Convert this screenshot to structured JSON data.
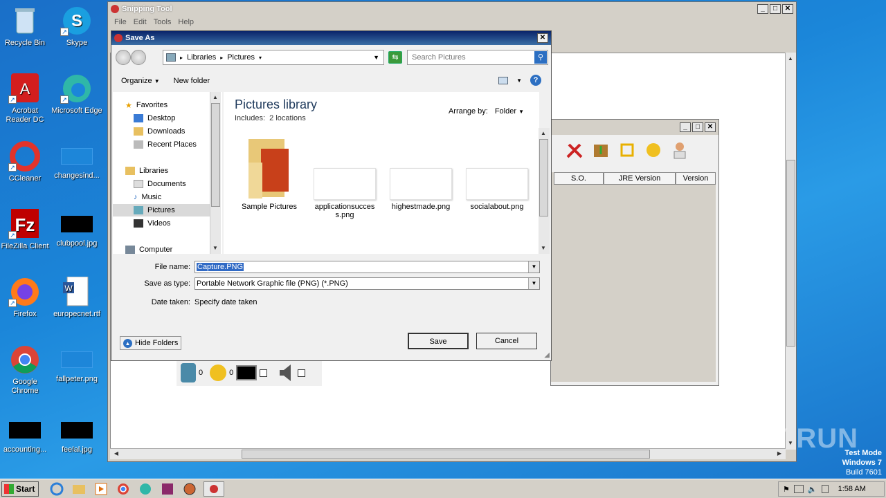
{
  "desktop": {
    "icons": [
      {
        "label": "Recycle Bin"
      },
      {
        "label": "Skype"
      },
      {
        "label": "Acrobat Reader DC"
      },
      {
        "label": "Microsoft Edge"
      },
      {
        "label": "CCleaner"
      },
      {
        "label": "changesind..."
      },
      {
        "label": "FileZilla Client"
      },
      {
        "label": "clubpool.jpg"
      },
      {
        "label": "Firefox"
      },
      {
        "label": "europecnet.rtf"
      },
      {
        "label": "Google Chrome"
      },
      {
        "label": "fallpeter.png"
      },
      {
        "label": "accounting..."
      },
      {
        "label": "feelal.jpg"
      }
    ]
  },
  "snipping_tool": {
    "title": "Snipping Tool",
    "menu": [
      "File",
      "Edit",
      "Tools",
      "Help"
    ]
  },
  "bg_app": {
    "columns": [
      "S.O.",
      "JRE Version",
      "Version"
    ],
    "counters": [
      "0",
      "0"
    ]
  },
  "dialog": {
    "title": "Save As",
    "address": {
      "crumb1": "Libraries",
      "crumb2": "Pictures"
    },
    "search_placeholder": "Search Pictures",
    "toolbar": {
      "organize": "Organize",
      "new_folder": "New folder",
      "help": "?"
    },
    "nav": {
      "favorites": "Favorites",
      "desktop": "Desktop",
      "downloads": "Downloads",
      "recent": "Recent Places",
      "libraries": "Libraries",
      "documents": "Documents",
      "music": "Music",
      "pictures": "Pictures",
      "videos": "Videos",
      "computer": "Computer"
    },
    "library_title": "Pictures library",
    "includes_label": "Includes:",
    "includes_value": "2 locations",
    "arrange_label": "Arrange by:",
    "arrange_value": "Folder",
    "files": [
      {
        "name": "Sample Pictures"
      },
      {
        "name": "applicationsuccess.png"
      },
      {
        "name": "highestmade.png"
      },
      {
        "name": "socialabout.png"
      }
    ],
    "file_name_label": "File name:",
    "file_name_value": "Capture.PNG",
    "save_type_label": "Save as type:",
    "save_type_value": "Portable Network Graphic file (PNG) (*.PNG)",
    "date_taken_label": "Date taken:",
    "date_taken_value": "Specify date taken",
    "hide_folders": "Hide Folders",
    "save": "Save",
    "cancel": "Cancel"
  },
  "taskbar": {
    "start": "Start",
    "time": "1:58 AM"
  },
  "watermark": {
    "brand": "ANY RUN",
    "line1": "Test Mode",
    "line2": "Windows 7",
    "line3": "Build 7601"
  }
}
